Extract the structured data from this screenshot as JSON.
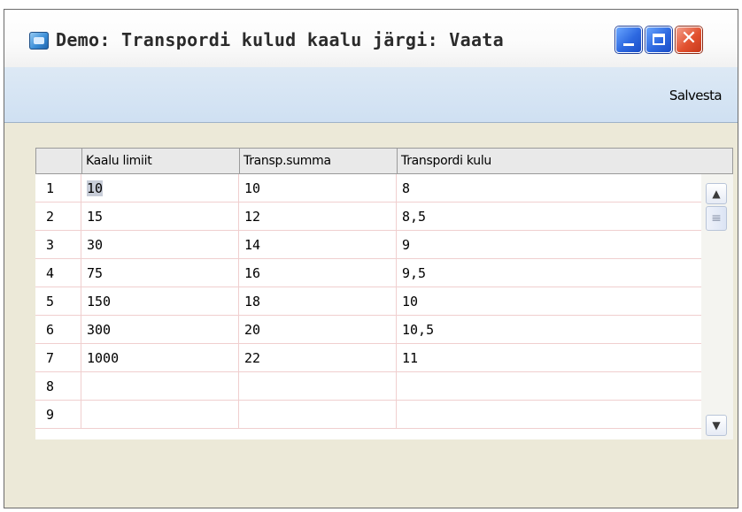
{
  "window": {
    "title": "Demo: Transpordi kulud kaalu järgi: Vaata",
    "icon": "app-window-icon",
    "controls": {
      "minimize": "minimize-icon",
      "maximize": "maximize-icon",
      "close": "close-icon"
    },
    "close_glyph": "✕"
  },
  "toolbar": {
    "save_label": "Salvesta"
  },
  "grid": {
    "columns": [
      "Kaalu limiit",
      "Transp.summa",
      "Transpordi kulu"
    ],
    "rows": [
      {
        "n": "1",
        "limit": "10",
        "summa": "10",
        "kulu": "8"
      },
      {
        "n": "2",
        "limit": "15",
        "summa": "12",
        "kulu": "8,5"
      },
      {
        "n": "3",
        "limit": "30",
        "summa": "14",
        "kulu": "9"
      },
      {
        "n": "4",
        "limit": "75",
        "summa": "16",
        "kulu": "9,5"
      },
      {
        "n": "5",
        "limit": "150",
        "summa": "18",
        "kulu": "10"
      },
      {
        "n": "6",
        "limit": "300",
        "summa": "20",
        "kulu": "10,5"
      },
      {
        "n": "7",
        "limit": "1000",
        "summa": "22",
        "kulu": "11"
      },
      {
        "n": "8",
        "limit": "",
        "summa": "",
        "kulu": ""
      },
      {
        "n": "9",
        "limit": "",
        "summa": "",
        "kulu": ""
      }
    ],
    "scroll": {
      "up_glyph": "▲",
      "down_glyph": "▼",
      "thumb_glyph": "≡"
    }
  },
  "colors": {
    "window_face": "#ece9d8",
    "toolbar": "#d5e3f3",
    "xp_blue": "#2d68e0",
    "xp_close": "#e2512f"
  }
}
